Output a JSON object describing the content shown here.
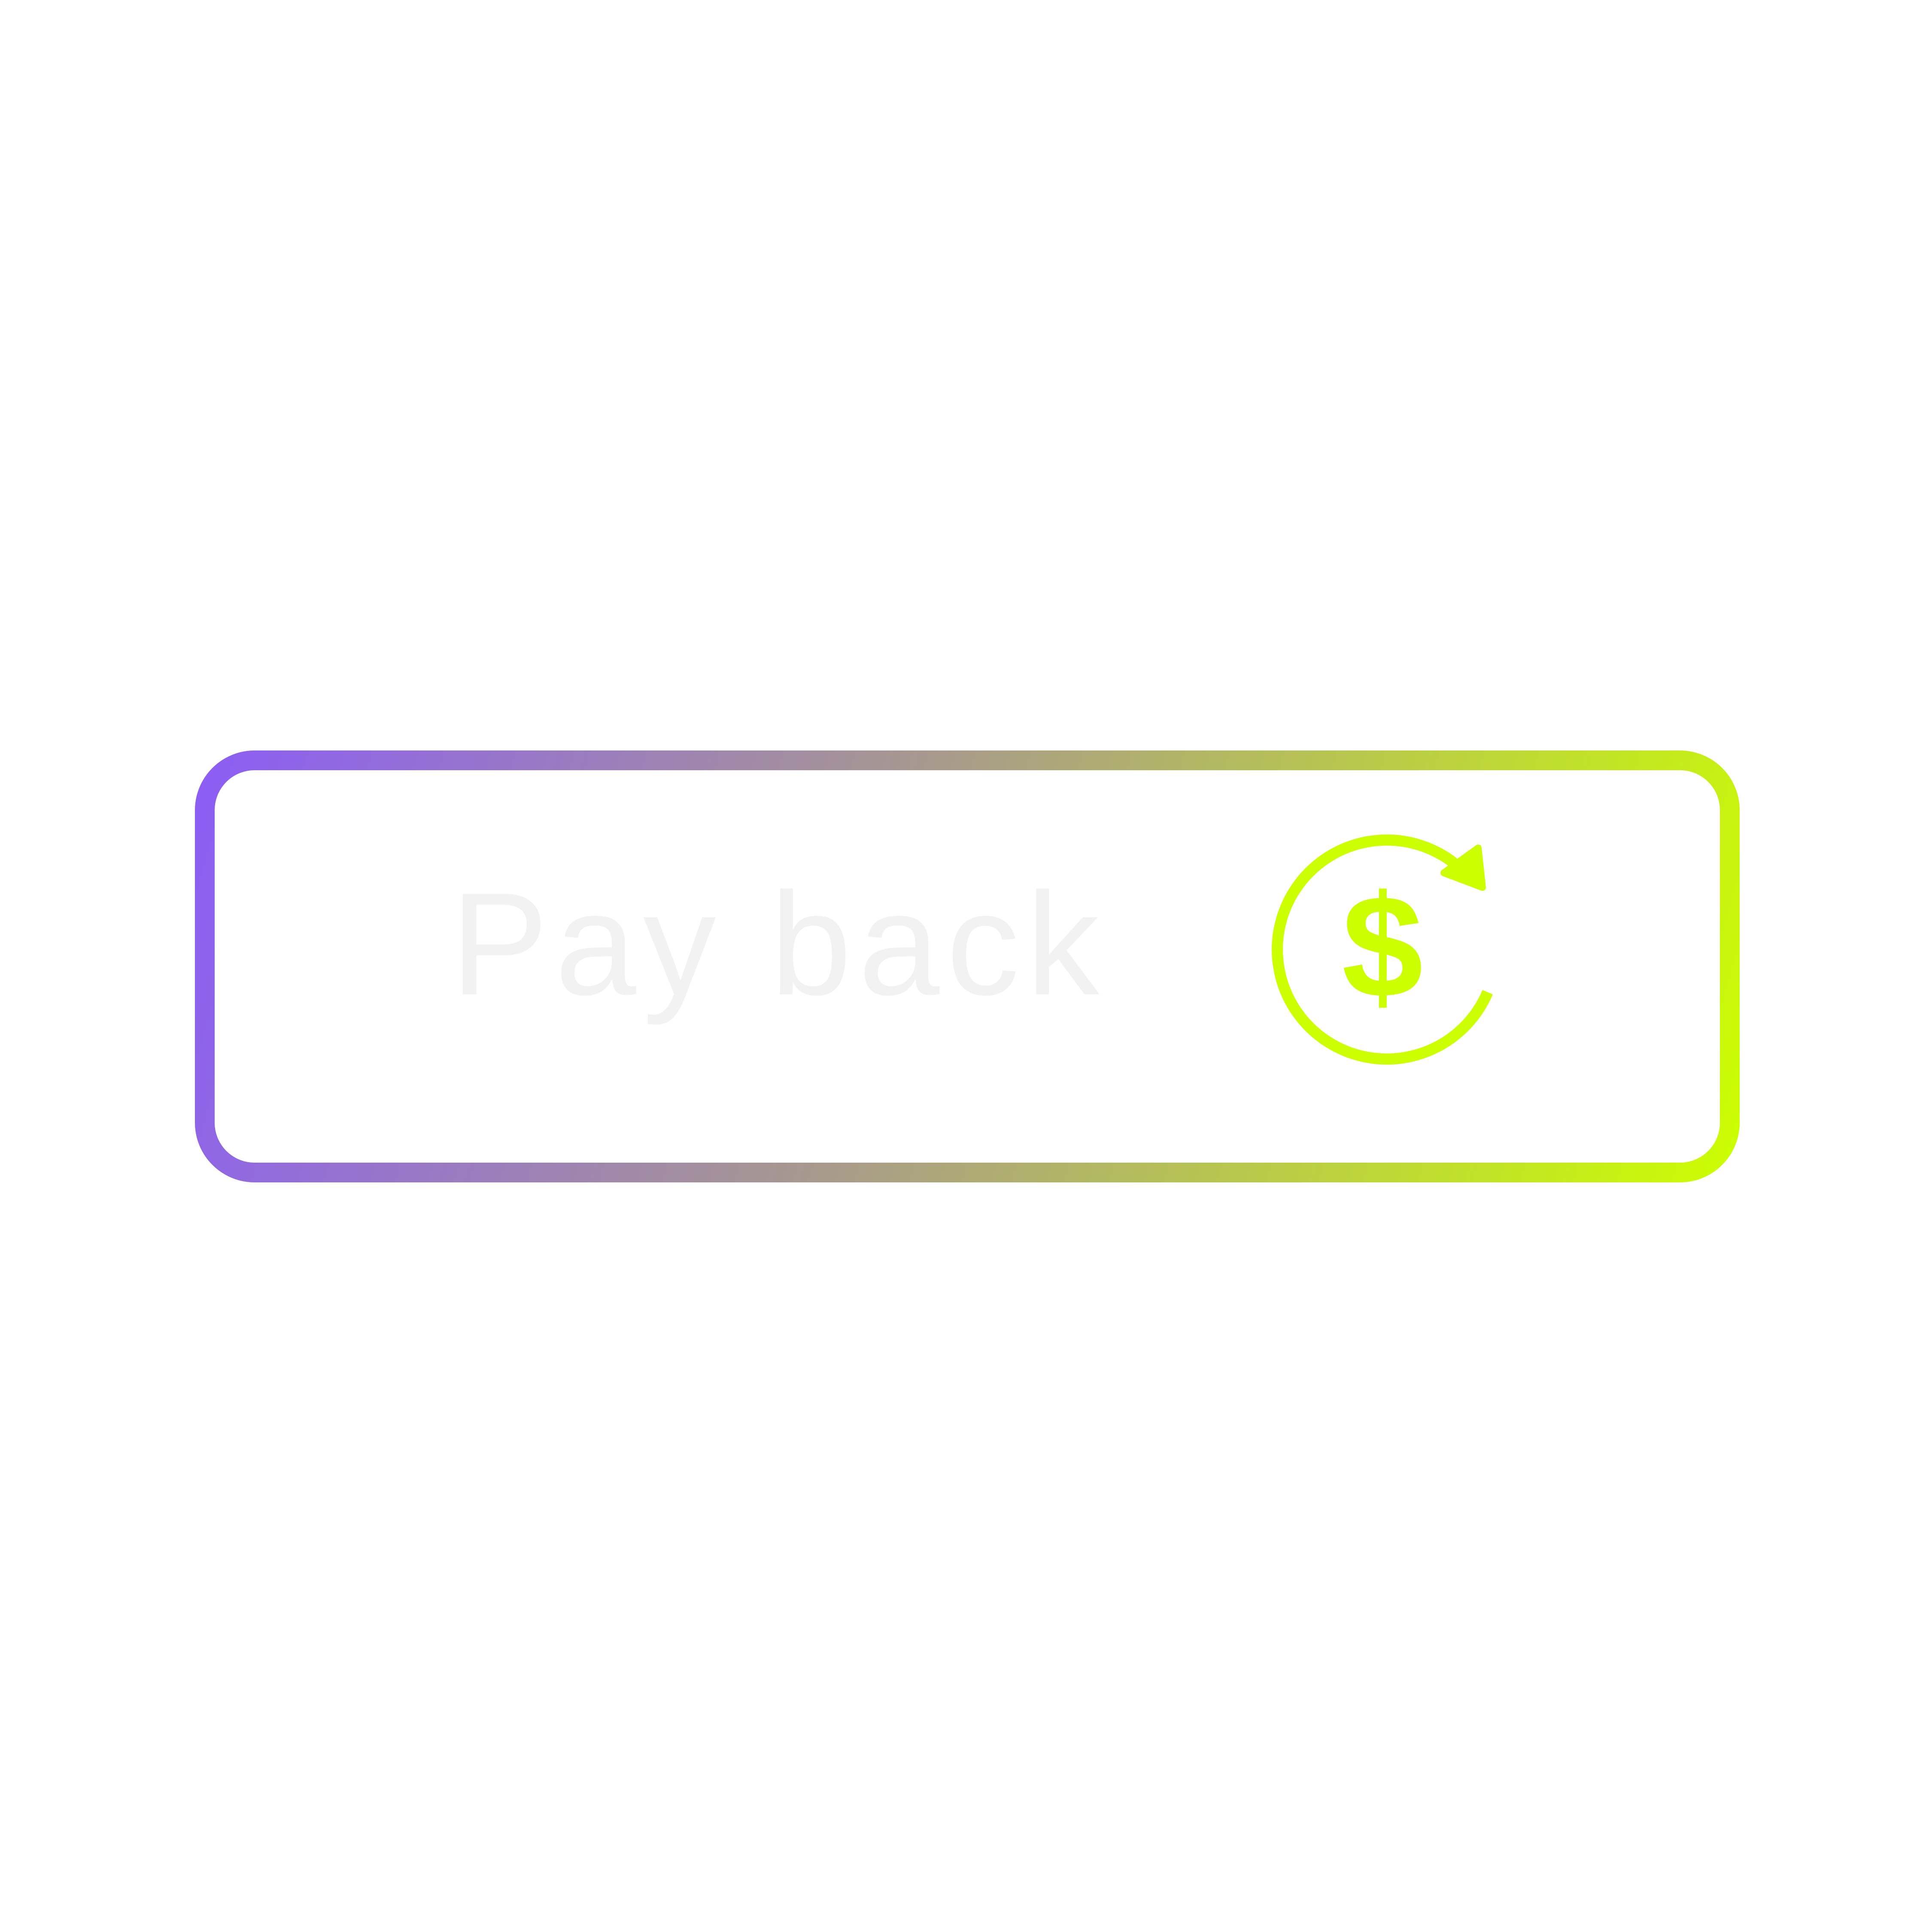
{
  "button": {
    "label": "Pay back",
    "icon": "refund-dollar-icon"
  },
  "colors": {
    "gradient_start": "#8b5cf6",
    "gradient_end": "#ccff00",
    "label_color": "#f2f2f2",
    "icon_color": "#ccff00",
    "background": "#ffffff"
  }
}
